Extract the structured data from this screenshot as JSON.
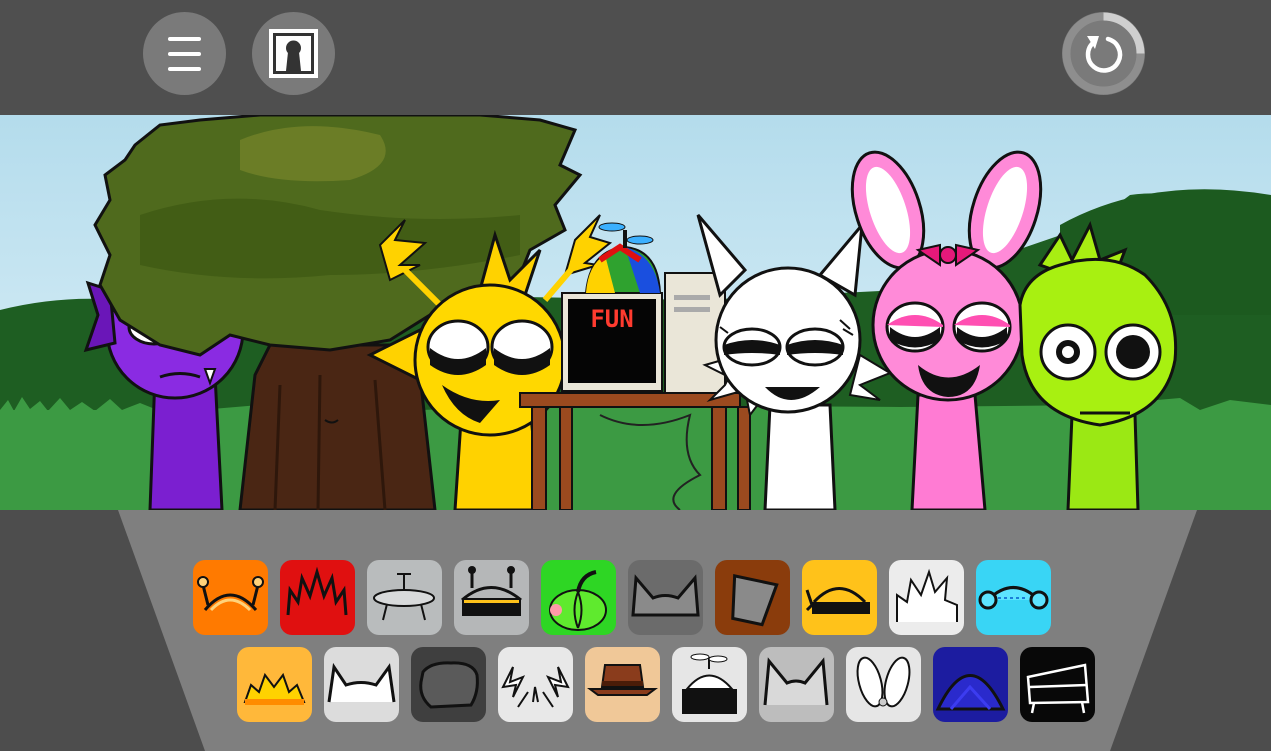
{
  "topbar": {
    "menu_icon": "hamburger-menu-icon",
    "frame_icon": "keyhole-frame-icon",
    "reset_icon": "reset-circular-arrow-icon",
    "reset_progress": 0.25
  },
  "scene": {
    "computer_screen_text": "FUN",
    "characters": [
      "purple-fish",
      "tree",
      "yellow-lightning",
      "computer-with-propeller-cap",
      "white-cat",
      "pink-bunny",
      "lime-green-spiky"
    ]
  },
  "palette": {
    "row1": [
      {
        "name": "orange-antenna-sound",
        "color": "#ff7a00"
      },
      {
        "name": "red-spiky-sound",
        "color": "#e01010"
      },
      {
        "name": "gray-ufo-sound",
        "color": "#b9bcbd"
      },
      {
        "name": "robot-antenna-sound",
        "color": "#b5b7b8"
      },
      {
        "name": "green-pumpkin-sound",
        "color": "#2ed624"
      },
      {
        "name": "gray-cat-ears-sound",
        "color": "#6b6b6b"
      },
      {
        "name": "bucket-hat-sound",
        "color": "#8a3c0c"
      },
      {
        "name": "yellow-headphones-sound",
        "color": "#ffc21a"
      },
      {
        "name": "white-spiky-hair-sound",
        "color": "#ececec"
      },
      {
        "name": "cyan-headphones-sound",
        "color": "#39d5f5"
      }
    ],
    "row2": [
      {
        "name": "sun-crown-sound",
        "color": "#ffb83a"
      },
      {
        "name": "horns-sound",
        "color": "#dcdcdc"
      },
      {
        "name": "dark-hair-sound",
        "color": "#3f3f3f"
      },
      {
        "name": "lightning-antennae-sound",
        "color": "#e8e8e8"
      },
      {
        "name": "fedora-sound",
        "color": "#f0c898"
      },
      {
        "name": "propeller-cap-sound",
        "color": "#e6e6e6"
      },
      {
        "name": "white-cat-ears-sound",
        "color": "#bdbdbd"
      },
      {
        "name": "bunny-ears-sound",
        "color": "#e6e6e6"
      },
      {
        "name": "blue-dome-sound",
        "color": "#1c1ca0"
      },
      {
        "name": "black-box-sound",
        "color": "#080808"
      }
    ]
  }
}
